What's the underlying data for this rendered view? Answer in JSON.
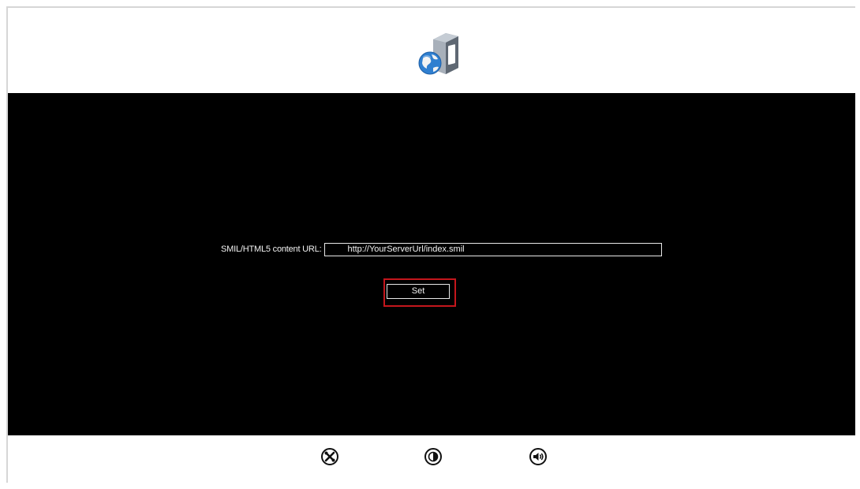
{
  "header": {
    "app_icon": "server-globe-icon"
  },
  "content": {
    "url_label": "SMIL/HTML5 content URL:",
    "url_value": "http://YourServerUrl/index.smil",
    "set_button_label": "Set",
    "highlight_color": "#c4161c"
  },
  "footer": {
    "icons": [
      "tools-icon",
      "contrast-icon",
      "volume-icon"
    ]
  }
}
